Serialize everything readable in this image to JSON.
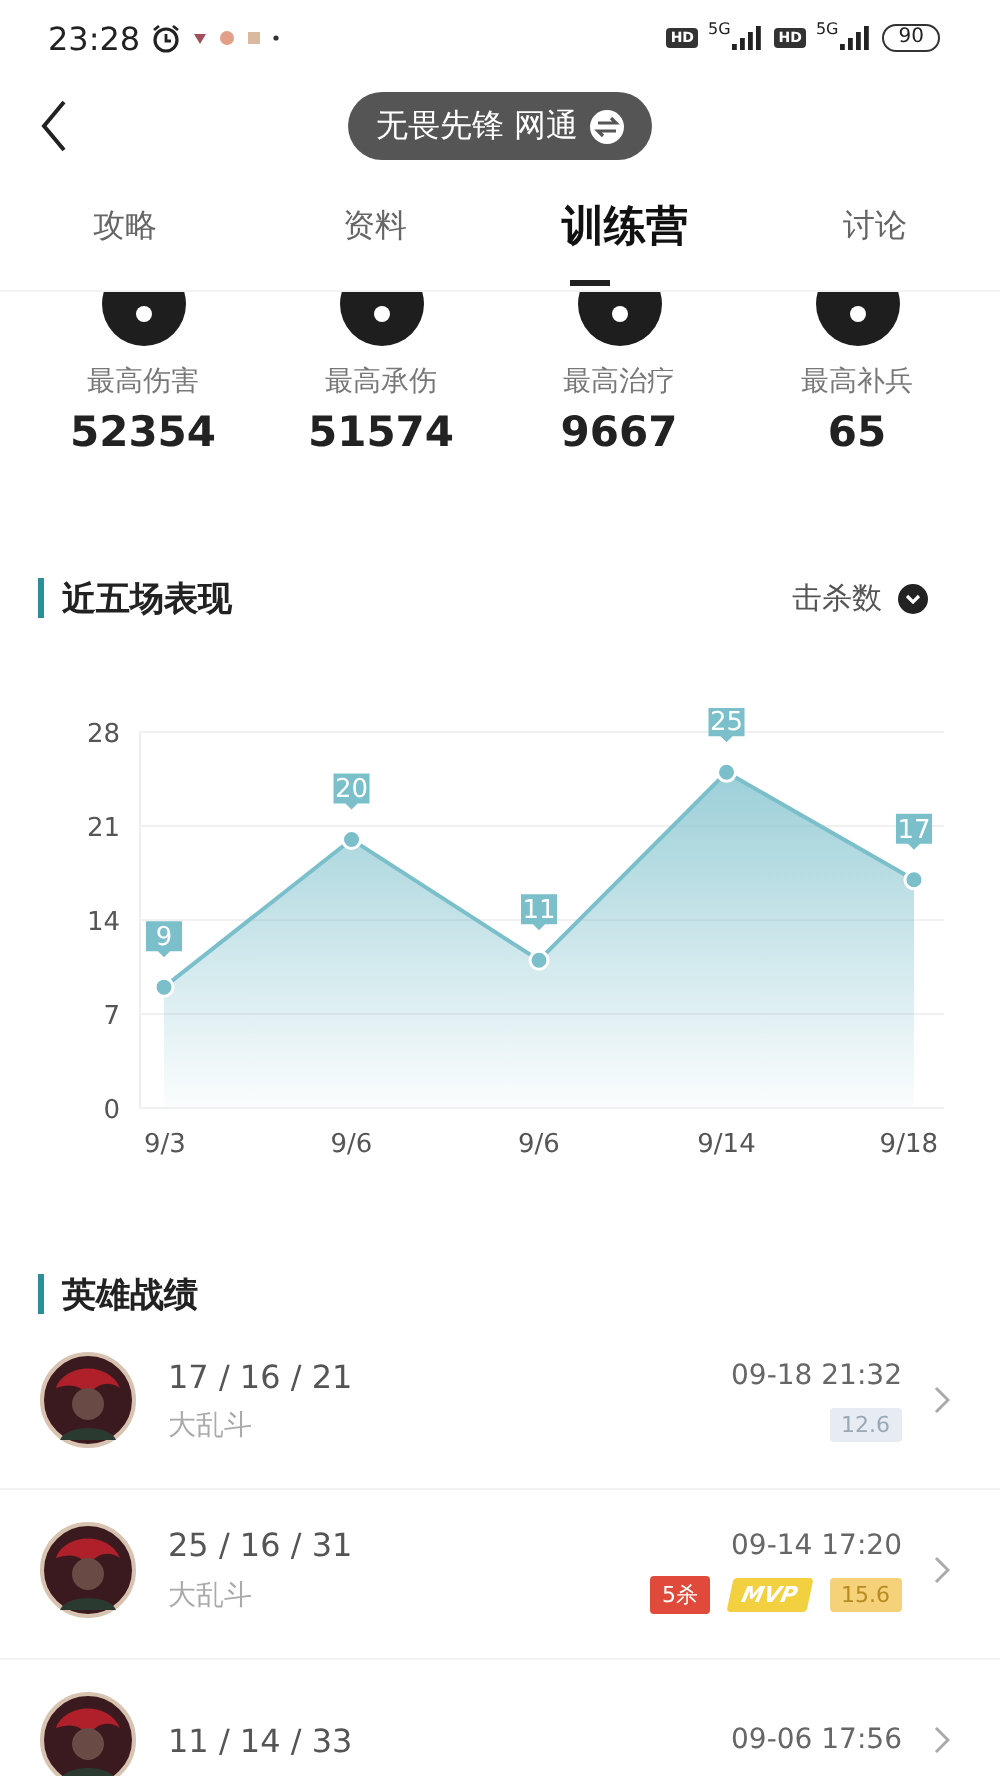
{
  "status_bar": {
    "time": "23:28",
    "network_1": "5G",
    "network_2": "5G",
    "hd_1": "HD",
    "hd_2": "HD",
    "battery": "90"
  },
  "header": {
    "server": "无畏先锋 网通"
  },
  "tabs": [
    {
      "label": "攻略",
      "selected": false
    },
    {
      "label": "资料",
      "selected": false
    },
    {
      "label": "训练营",
      "selected": true
    },
    {
      "label": "讨论",
      "selected": false
    }
  ],
  "stats": [
    {
      "label": "最高伤害",
      "value": "52354"
    },
    {
      "label": "最高承伤",
      "value": "51574"
    },
    {
      "label": "最高治疗",
      "value": "9667"
    },
    {
      "label": "最高补兵",
      "value": "65"
    }
  ],
  "recent": {
    "title": "近五场表现",
    "metric": "击杀数",
    "chart_data": {
      "type": "area",
      "categories": [
        "9/3",
        "9/6",
        "9/6",
        "9/14",
        "9/18"
      ],
      "series": [
        {
          "color": "#7bbfcb",
          "values": [
            9,
            20,
            11,
            25,
            17
          ]
        }
      ],
      "ylim": [
        0,
        28
      ],
      "yticks": [
        0,
        7,
        14,
        21,
        28
      ],
      "data_labels": true,
      "grid": true
    }
  },
  "records": {
    "title": "英雄战绩",
    "rows": [
      {
        "kda": "17 / 16 / 21",
        "time": "09-18 21:32",
        "mode": "大乱斗",
        "badges": [
          {
            "kind": "score",
            "text": "12.6"
          }
        ]
      },
      {
        "kda": "25 / 16 / 31",
        "time": "09-14 17:20",
        "mode": "大乱斗",
        "badges": [
          {
            "kind": "penta",
            "text": "5杀"
          },
          {
            "kind": "mvp",
            "text": "MVP"
          },
          {
            "kind": "score-gold",
            "text": "15.6"
          }
        ]
      },
      {
        "kda": "11 / 14 / 33",
        "time": "09-06 17:56"
      }
    ]
  }
}
